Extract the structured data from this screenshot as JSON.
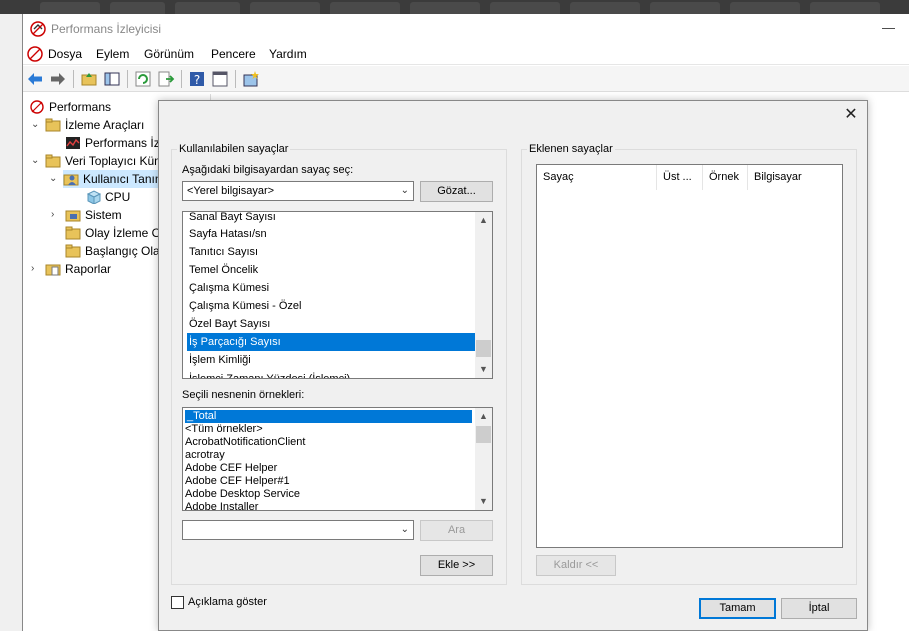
{
  "window": {
    "title": "Performans İzleyicisi"
  },
  "menu": [
    "Dosya",
    "Eylem",
    "Görünüm",
    "Pencere",
    "Yardım"
  ],
  "tree": {
    "root": "Performans",
    "monitoring_tools": "İzleme Araçları",
    "performance_monitor": "Performans İzl",
    "data_collector_sets": "Veri Toplayıcı Küm",
    "user_defined": "Kullanıcı Tanım",
    "cpu": "CPU",
    "system": "Sistem",
    "event_trace": "Olay İzleme O",
    "startup_events": "Başlangıç Olay",
    "reports": "Raporlar"
  },
  "dialog": {
    "available_counters_group": "Kullanılabilen sayaçlar",
    "select_computer_label": "Aşağıdaki bilgisayardan sayaç seç:",
    "computer_value": "<Yerel bilgisayar>",
    "browse_button": "Gözat...",
    "counters": [
      "Sanal Bayt Sayısı",
      "Sayfa Hatası/sn",
      "Tanıtıcı Sayısı",
      "Temel Öncelik",
      "Çalışma Kümesi",
      "Çalışma Kümesi - Özel",
      "Özel Bayt Sayısı",
      "İş Parçacığı Sayısı",
      "İşlem Kimliği",
      "İşlemci Zamanı Yüzdesi (İşlemci)"
    ],
    "instances_label": "Seçili nesnenin örnekleri:",
    "instances": [
      "_Total",
      "<Tüm örnekler>",
      "AcrobatNotificationClient",
      "acrotray",
      "Adobe CEF Helper",
      "Adobe CEF Helper#1",
      "Adobe Desktop Service",
      "Adobe Installer"
    ],
    "search_value": "",
    "search_button": "Ara",
    "add_button": "Ekle >>",
    "added_counters_group": "Eklenen sayaçlar",
    "columns": [
      "Sayaç",
      "Üst ...",
      "Örnek",
      "Bilgisayar"
    ],
    "remove_button": "Kaldır <<",
    "show_description": "Açıklama göster",
    "ok_button": "Tamam",
    "cancel_button": "İptal"
  }
}
